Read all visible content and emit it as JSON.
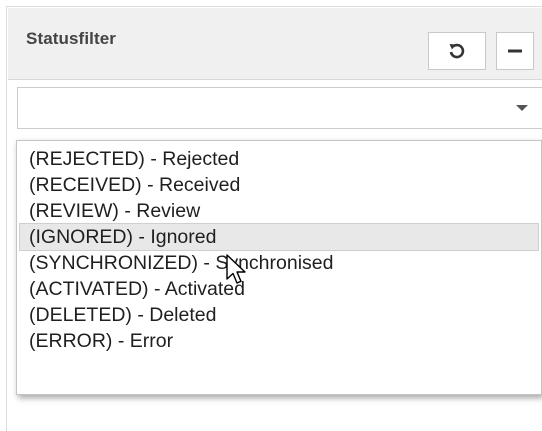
{
  "panel": {
    "title": "Statusfilter",
    "buttons": {
      "reset_icon": "refresh-icon",
      "minimize_icon": "minus-icon"
    }
  },
  "select": {
    "value": "",
    "arrow_icon": "caret-down-icon"
  },
  "dropdown": {
    "options": [
      "(REJECTED) - Rejected",
      "(RECEIVED) - Received",
      "(REVIEW) - Review",
      "(IGNORED) - Ignored",
      "(SYNCHRONIZED) - Synchronised",
      "(ACTIVATED) - Activated",
      "(DELETED) - Deleted",
      "(ERROR) - Error"
    ],
    "hovered_index": 3
  },
  "cursor_icon": "mouse-pointer-icon"
}
